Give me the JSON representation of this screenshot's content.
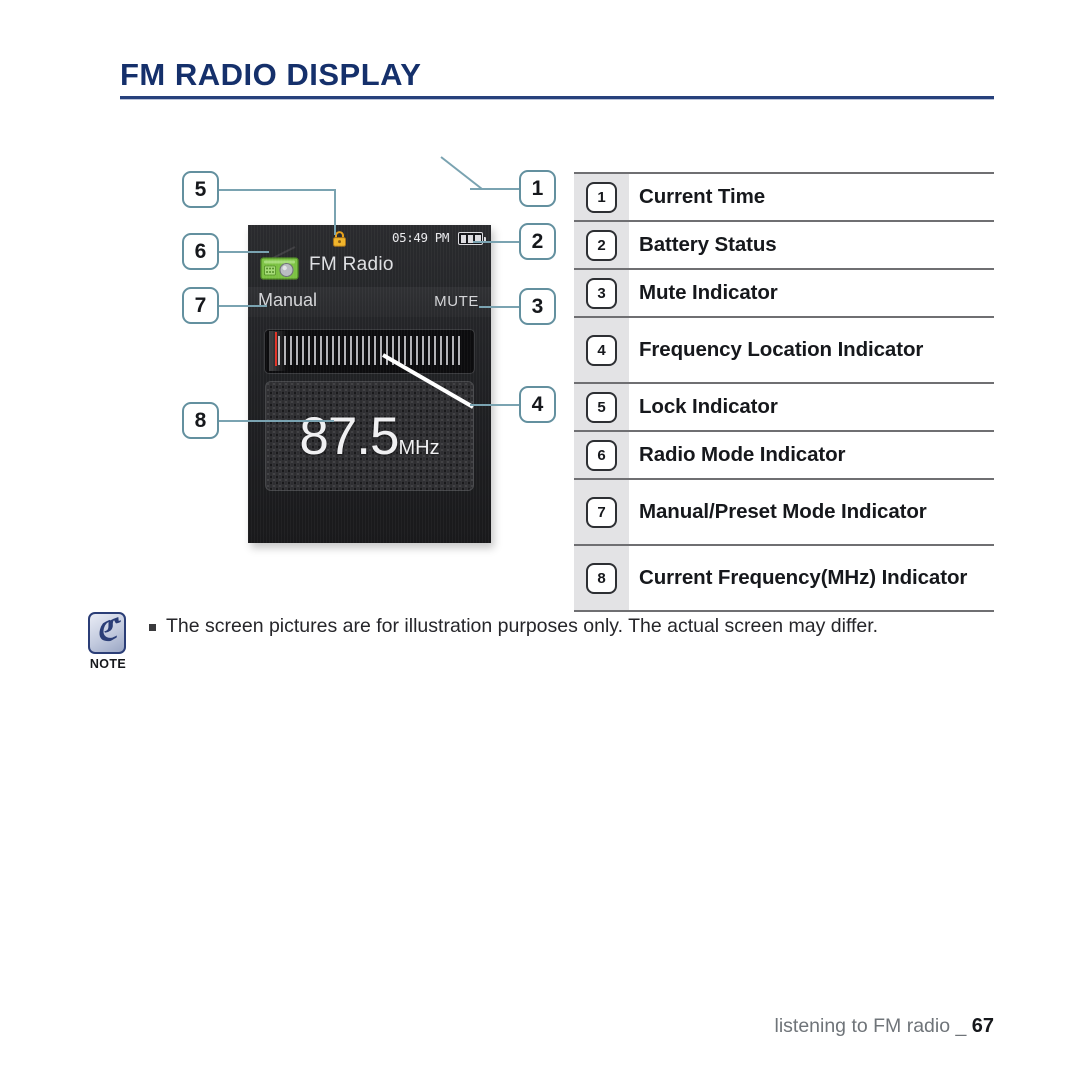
{
  "page": {
    "title": "FM RADIO DISPLAY",
    "footer_text": "listening to FM radio _",
    "footer_page": "67"
  },
  "device_screen": {
    "lock_icon": "lock-icon",
    "radio_icon": "radio-mode-icon",
    "battery_icon": "battery-icon",
    "time": "05:49 PM",
    "app_title": "FM Radio",
    "mode": "Manual",
    "mute": "MUTE",
    "frequency": "87.5",
    "frequency_unit": "MHz"
  },
  "callouts": [
    {
      "id": "1",
      "target": "current-time"
    },
    {
      "id": "2",
      "target": "battery-status"
    },
    {
      "id": "3",
      "target": "mute-indicator"
    },
    {
      "id": "4",
      "target": "frequency-location"
    },
    {
      "id": "5",
      "target": "lock-indicator"
    },
    {
      "id": "6",
      "target": "radio-mode"
    },
    {
      "id": "7",
      "target": "manual-preset-mode"
    },
    {
      "id": "8",
      "target": "current-frequency"
    }
  ],
  "legend": {
    "rows": [
      {
        "num": "1",
        "label": "Current Time",
        "lines": 1
      },
      {
        "num": "2",
        "label": "Battery Status",
        "lines": 1
      },
      {
        "num": "3",
        "label": "Mute Indicator",
        "lines": 1
      },
      {
        "num": "4",
        "label": "Frequency Location Indicator",
        "lines": 2
      },
      {
        "num": "5",
        "label": "Lock Indicator",
        "lines": 1
      },
      {
        "num": "6",
        "label": "Radio Mode Indicator",
        "lines": 1
      },
      {
        "num": "7",
        "label": "Manual/Preset Mode Indicator",
        "lines": 2
      },
      {
        "num": "8",
        "label": "Current Frequency(MHz) Indicator",
        "lines": 2
      }
    ]
  },
  "note": {
    "label": "NOTE",
    "text": "The screen pictures are for illustration purposes only. The actual screen may differ."
  },
  "colors": {
    "title": "#15306b",
    "rule": "#27417c",
    "callout_border": "#63909f",
    "leader": "#7aa3b1",
    "legend_divider": "#6f6f72",
    "num_cell_bg": "#e3e3e5",
    "tuner_marker": "#e03125",
    "note_border": "#2b3e77"
  }
}
